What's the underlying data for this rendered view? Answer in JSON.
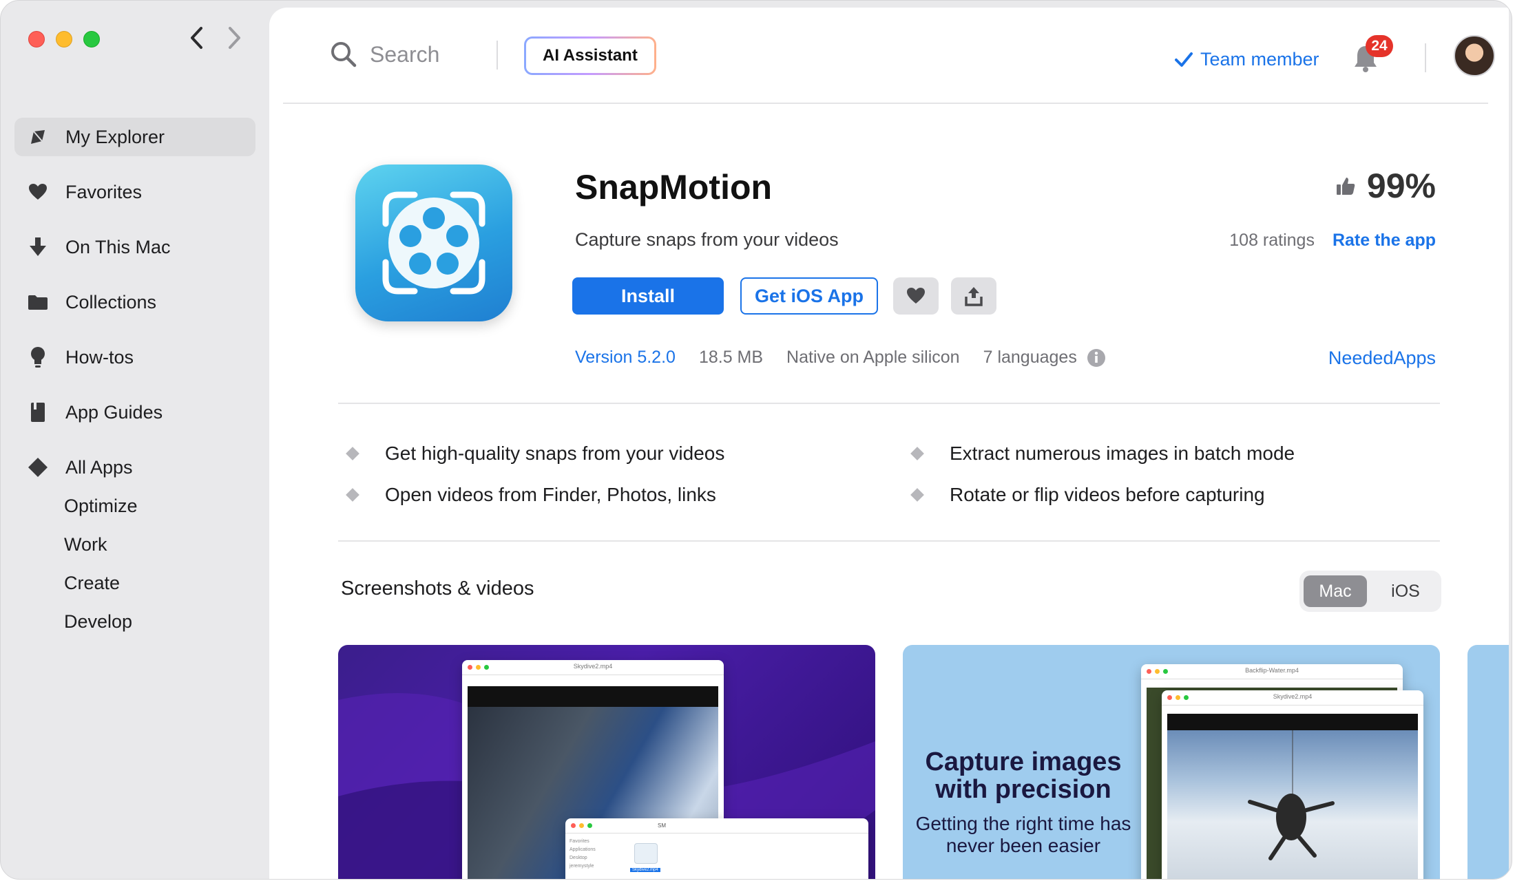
{
  "sidebar": {
    "items": [
      {
        "label": "My Explorer",
        "icon": "explorer-icon",
        "active": true
      },
      {
        "label": "Favorites",
        "icon": "heart-icon"
      },
      {
        "label": "On This Mac",
        "icon": "download-icon"
      },
      {
        "label": "Collections",
        "icon": "folder-icon"
      },
      {
        "label": "How-tos",
        "icon": "lightbulb-icon"
      },
      {
        "label": "App Guides",
        "icon": "book-icon"
      },
      {
        "label": "All Apps",
        "icon": "diamond-icon"
      }
    ],
    "sub_items": [
      "Optimize",
      "Work",
      "Create",
      "Develop"
    ]
  },
  "topbar": {
    "search_placeholder": "Search",
    "ai_label": "AI Assistant",
    "team_label": "Team member",
    "notifications": "24"
  },
  "app": {
    "name": "SnapMotion",
    "subtitle": "Capture snaps from your videos",
    "rating_pct": "99%",
    "ratings_count": "108 ratings",
    "rate_label": "Rate the app",
    "install_label": "Install",
    "ios_label": "Get iOS App",
    "version": "Version 5.2.0",
    "size": "18.5 MB",
    "native": "Native on Apple silicon",
    "languages": "7 languages",
    "developer": "NeededApps"
  },
  "features": [
    "Get high-quality snaps from your videos",
    "Extract numerous images in batch mode",
    "Open videos from Finder, Photos, links",
    "Rotate or flip videos before capturing"
  ],
  "screenshots": {
    "title": "Screenshots & videos",
    "platforms": [
      "Mac",
      "iOS"
    ],
    "selected": "Mac",
    "shot2_heading": "Capture images with precision",
    "shot2_sub": "Getting the right time has never been easier",
    "shot1_window_title": "Skydive2.mp4",
    "shot1_finder_title": "SM",
    "shot1_finder_items": [
      "Favorites",
      "Applications",
      "Desktop",
      "jeremystyle"
    ],
    "shot1_file_label": "Skydive2.mp4",
    "shot2_back_title": "Backflip-Water.mp4",
    "shot2_front_title": "Skydive2.mp4"
  },
  "colors": {
    "accent": "#1a73e8",
    "badge": "#e5332a"
  }
}
